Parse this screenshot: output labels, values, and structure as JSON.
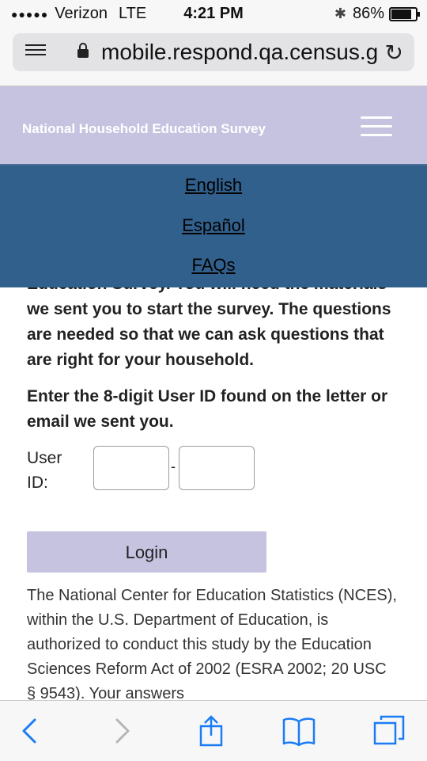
{
  "status_bar": {
    "signal_dots": "●●●●●",
    "carrier": "Verizon",
    "network": "LTE",
    "time": "4:21 PM",
    "battery_percent": "86%",
    "battery_level": 0.86
  },
  "browser": {
    "url": "mobile.respond.qa.census.g"
  },
  "header": {
    "site_title": "National Household Education Survey"
  },
  "nav": {
    "items": [
      {
        "label": "English"
      },
      {
        "label": "Español"
      },
      {
        "label": "FAQs"
      }
    ]
  },
  "main": {
    "intro_text": "Education Survey. You will need the materials we sent you to start the survey. The questions are needed so that we can ask questions that are right for your household.",
    "instruction_text": "Enter the 8-digit User ID found on the letter or email we sent you.",
    "userid_label": "User ID:",
    "userid_separator": "-",
    "userid_part1": "",
    "userid_part2": "",
    "login_label": "Login",
    "legal_text": "The National Center for Education Statistics (NCES), within the U.S. Department of Education, is authorized to conduct this study by the Education Sciences Reform Act of 2002 (ESRA 2002; 20 USC § 9543). Your answers"
  },
  "colors": {
    "header_bg": "#c6c3e1",
    "nav_bg": "#31608c",
    "button_bg": "#c6c3e1",
    "ios_blue": "#1a7cf5"
  }
}
